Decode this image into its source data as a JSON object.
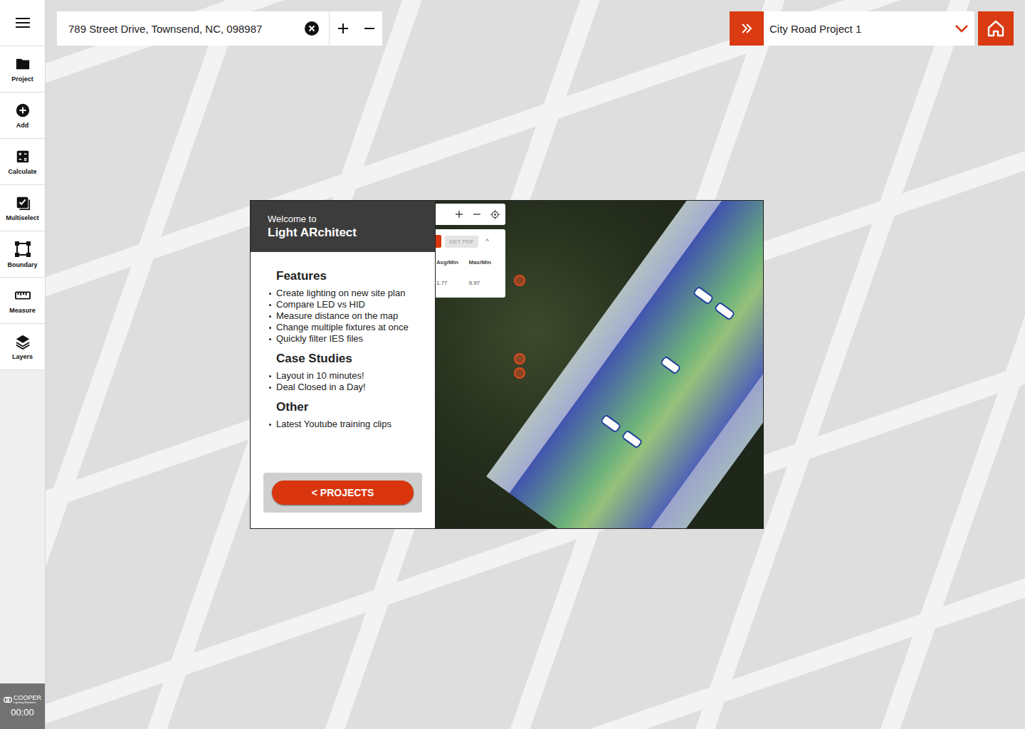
{
  "search": {
    "value": "789 Street Drive, Townsend, NC, 098987"
  },
  "project": {
    "name": "City Road Project 1"
  },
  "sidebar": {
    "items": [
      {
        "label": "Project"
      },
      {
        "label": "Add"
      },
      {
        "label": "Calculate"
      },
      {
        "label": "Multiselect"
      },
      {
        "label": "Boundary"
      },
      {
        "label": "Measure"
      },
      {
        "label": "Layers"
      }
    ]
  },
  "footer": {
    "brand": "COOPER",
    "tagline": "Lighting Solutions",
    "time": "00:00"
  },
  "welcome": {
    "greeting": "Welcome to",
    "title": "Light ARchitect",
    "sections": [
      {
        "heading": "Features",
        "items": [
          "Create lighting on new site plan",
          "Compare LED vs HID",
          "Measure distance on the map",
          "Change multiple fixtures at once",
          "Quickly filter IES files"
        ]
      },
      {
        "heading": "Case Studies",
        "items": [
          "Layout in 10 minutes!",
          "Deal Closed in a Day!"
        ]
      },
      {
        "heading": "Other",
        "items": [
          "Latest Youtube training clips"
        ]
      }
    ],
    "button": "< PROJECTS"
  },
  "preview": {
    "pdf_button": "GET PDF",
    "caret": "^",
    "columns": [
      "Avg/Min",
      "Max/Min"
    ],
    "values": [
      "1.77",
      "9.97"
    ]
  }
}
